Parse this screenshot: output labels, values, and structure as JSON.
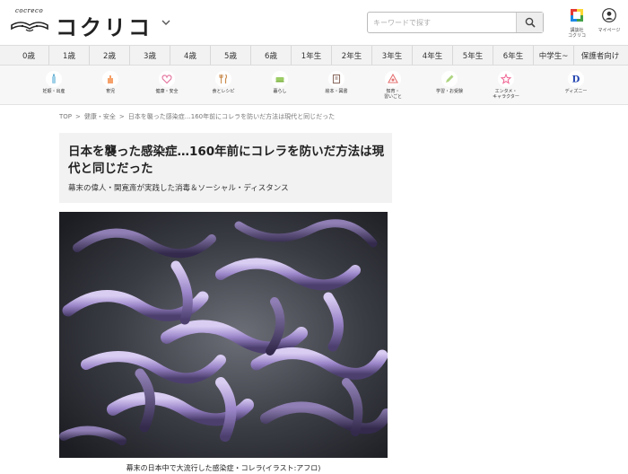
{
  "header": {
    "logo_small": "cocreco",
    "logo_text": "コクリコ",
    "search_placeholder": "キーワードで探す",
    "icons": [
      {
        "name": "kodansha-icon",
        "label": "講談社\nコクリコ"
      },
      {
        "name": "mypage-icon",
        "label": "マイページ"
      }
    ]
  },
  "age_tabs": [
    "0歳",
    "1歳",
    "2歳",
    "3歳",
    "4歳",
    "5歳",
    "6歳",
    "1年生",
    "2年生",
    "3年生",
    "4年生",
    "5年生",
    "6年生",
    "中学生~",
    "保護者向け"
  ],
  "categories": [
    {
      "label": "妊娠・出産",
      "icon": "baby-bottle-icon"
    },
    {
      "label": "育児",
      "icon": "hand-icon"
    },
    {
      "label": "健康・安全",
      "icon": "heart-icon"
    },
    {
      "label": "食とレシピ",
      "icon": "cutlery-icon"
    },
    {
      "label": "暮らし",
      "icon": "sofa-icon"
    },
    {
      "label": "絵本・図書",
      "icon": "book-icon"
    },
    {
      "label": "知育・\n習いごと",
      "icon": "blocks-icon"
    },
    {
      "label": "学習・お受験",
      "icon": "pencil-icon"
    },
    {
      "label": "エンタメ・\nキャラクター",
      "icon": "star-icon"
    },
    {
      "label": "ディズニー",
      "icon": "disney-icon"
    }
  ],
  "breadcrumb": [
    "TOP",
    "健康・安全",
    "日本を襲った感染症…160年前にコレラを防いだ方法は現代と同じだった"
  ],
  "article": {
    "title": "日本を襲った感染症…160年前にコレラを防いだ方法は現代と同じだった",
    "subtitle": "幕末の偉人・関寛斎が実践した消毒＆ソーシャル・ディスタンス",
    "caption": "幕末の日本中で大流行した感染症・コレラ(イラスト:アフロ)"
  },
  "colors": {
    "accent": "#444444",
    "panel": "#f2f2f2",
    "bacteria": "#9b86c9"
  }
}
